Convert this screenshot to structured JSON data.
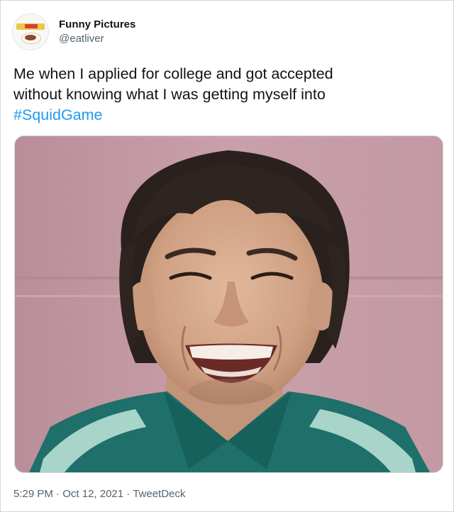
{
  "author": {
    "display_name": "Funny Pictures",
    "handle": "@eatliver",
    "avatar_icon": "eatliver-logo-icon"
  },
  "tweet": {
    "text_line_1": "Me when I applied for college and got accepted",
    "text_line_2": "without knowing what I was getting myself into",
    "hashtag": "#SquidGame"
  },
  "media": {
    "description_icon": "photo-smiling-man-icon"
  },
  "meta": {
    "time": "5:29 PM",
    "separator": "·",
    "date": "Oct 12, 2021",
    "source": "TweetDeck"
  },
  "colors": {
    "hashtag": "#1d9bf0",
    "text": "#0f1419",
    "secondary": "#536471",
    "wall": "#c49aa4",
    "jacket": "#1f6f6a",
    "jacket_stripe": "#a8d4c9"
  }
}
